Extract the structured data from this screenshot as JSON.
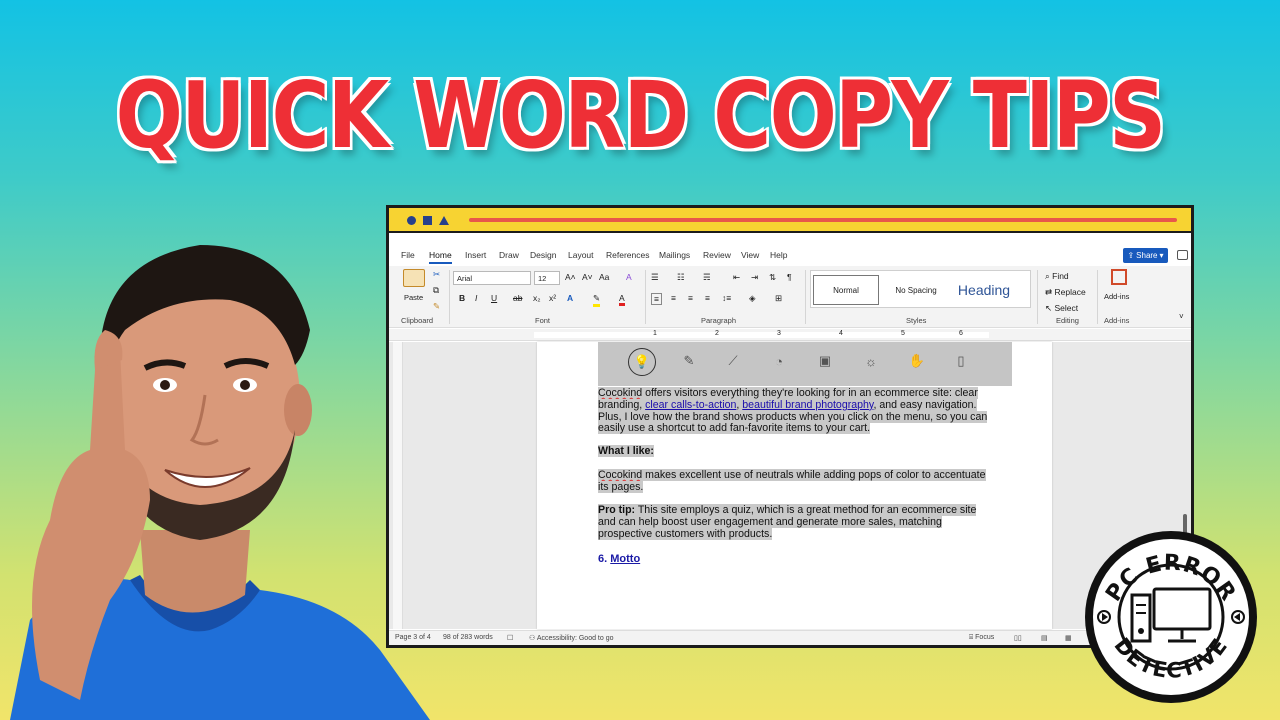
{
  "headline": "QUICK WORD COPY TIPS",
  "badge": {
    "top_text": "PC ERROR",
    "bottom_text": "DETECTIVE"
  },
  "word": {
    "menu": [
      "File",
      "Home",
      "Insert",
      "Draw",
      "Design",
      "Layout",
      "References",
      "Mailings",
      "Review",
      "View",
      "Help"
    ],
    "active_tab": "Home",
    "share_label": "Share",
    "ribbon": {
      "clipboard": {
        "paste": "Paste",
        "label": "Clipboard"
      },
      "font": {
        "name": "Arial",
        "size": "12",
        "label": "Font",
        "buttons": [
          "B",
          "I",
          "U",
          "ab",
          "x₂",
          "x²"
        ]
      },
      "paragraph": {
        "label": "Paragraph"
      },
      "styles": {
        "normal": "Normal",
        "no_spacing": "No Spacing",
        "heading": "Heading",
        "label": "Styles"
      },
      "editing": {
        "find": "Find",
        "replace": "Replace",
        "select": "Select",
        "label": "Editing"
      },
      "addins": {
        "button": "Add-ins",
        "label": "Add-ins"
      }
    },
    "ruler_numbers": [
      "1",
      "2",
      "3",
      "4",
      "5",
      "6"
    ],
    "document": {
      "para1": {
        "brand": "Cocokind",
        "text1": " offers visitors everything they're looking for in an ecommerce site: clear branding, ",
        "link1": "clear calls-to-action",
        "text2": ", ",
        "link2": "beautiful brand photography",
        "text3": ", and easy navigation. Plus, I love how the brand shows products when you click on the menu, so you can easily use a shortcut to add fan-favorite items to your cart."
      },
      "what_i_like": "What I like:",
      "para2": {
        "brand": "Cocokind",
        "text": " makes excellent use of neutrals while adding pops of color to accentuate its pages."
      },
      "para3": {
        "label": "Pro tip:",
        "text": " This site employs a quiz, which is a great method for an ecommerce site and can help boost user engagement and generate more sales, matching prospective customers with products."
      },
      "heading_number": "6. ",
      "heading_link": "Motto"
    },
    "status": {
      "page": "Page 3 of 4",
      "words": "98 of 283 words",
      "accessibility": "Accessibility: Good to go",
      "focus": "Focus"
    }
  },
  "colors": {
    "headline": "#ee2f36",
    "window_titlebar": "#f7d332",
    "accent": "#185abd",
    "shirt": "#1f6fd8"
  }
}
